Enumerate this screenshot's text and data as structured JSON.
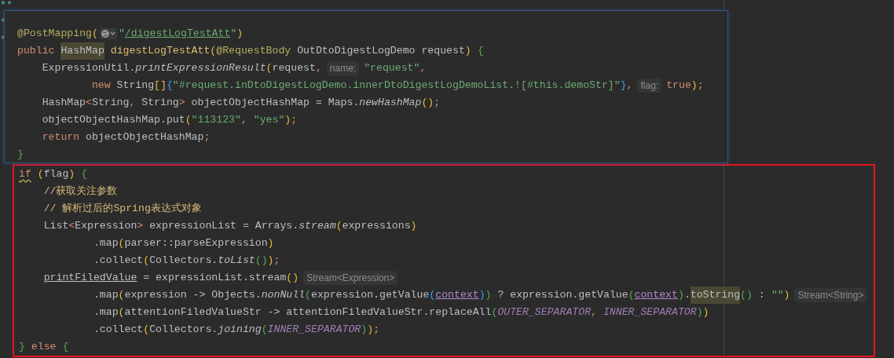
{
  "background_lines": [
    "**",
    "*",
    "*"
  ],
  "popup": {
    "lines": [
      {
        "kind": "top",
        "tokens": [
          {
            "kind": "ann",
            "text": "@PostMapping"
          },
          {
            "kind": "b1",
            "text": "("
          },
          {
            "kind": "url-icon"
          },
          {
            "kind": "str",
            "text": "\""
          },
          {
            "kind": "link",
            "text": "/digestLogTestAtt"
          },
          {
            "kind": "str",
            "text": "\""
          },
          {
            "kind": "b1",
            "text": ")"
          }
        ]
      },
      {
        "kind": "top",
        "tokens": [
          {
            "kind": "kw",
            "text": "public "
          },
          {
            "kind": "match",
            "text": "HashMap"
          },
          {
            "kind": "decl",
            "text": " digestLogTestAtt"
          },
          {
            "kind": "b1",
            "text": "("
          },
          {
            "kind": "ann",
            "text": "@RequestBody"
          },
          {
            "kind": "plain",
            "text": " OutDtoDigestLogDemo request"
          },
          {
            "kind": "b1",
            "text": ")"
          },
          {
            "kind": "b2",
            "text": " {"
          }
        ]
      },
      {
        "kind": "body",
        "tokens": [
          {
            "kind": "plain",
            "text": "ExpressionUtil."
          },
          {
            "kind": "static",
            "text": "printExpressionResult"
          },
          {
            "kind": "b1",
            "text": "("
          },
          {
            "kind": "plain",
            "text": "request"
          },
          {
            "kind": "kw",
            "text": ","
          },
          {
            "kind": "hint",
            "text": "name:"
          },
          {
            "kind": "str",
            "text": "\"request\""
          },
          {
            "kind": "kw",
            "text": ","
          }
        ]
      },
      {
        "kind": "cont",
        "tokens": [
          {
            "kind": "kw",
            "text": "new "
          },
          {
            "kind": "plain",
            "text": "String"
          },
          {
            "kind": "b1",
            "text": "[]"
          },
          {
            "kind": "b3",
            "text": "{"
          },
          {
            "kind": "str",
            "text": "\"#request.inDtoDigestLogDemo.innerDtoDigestLogDemoList.![#this.demoStr]\""
          },
          {
            "kind": "b3",
            "text": "}"
          },
          {
            "kind": "kw",
            "text": ","
          },
          {
            "kind": "hint",
            "text": "flag:"
          },
          {
            "kind": "kw",
            "text": "true"
          },
          {
            "kind": "b1",
            "text": ")"
          },
          {
            "kind": "kw",
            "text": ";"
          }
        ]
      },
      {
        "kind": "body",
        "tokens": [
          {
            "kind": "plain",
            "text": "HashMap"
          },
          {
            "kind": "kw",
            "text": "<"
          },
          {
            "kind": "plain",
            "text": "String"
          },
          {
            "kind": "kw",
            "text": ","
          },
          {
            "kind": "plain",
            "text": " String"
          },
          {
            "kind": "kw",
            "text": ">"
          },
          {
            "kind": "plain",
            "text": " objectObjectHashMap = Maps."
          },
          {
            "kind": "static",
            "text": "newHashMap"
          },
          {
            "kind": "b1",
            "text": "()"
          },
          {
            "kind": "kw",
            "text": ";"
          }
        ]
      },
      {
        "kind": "body",
        "tokens": [
          {
            "kind": "plain",
            "text": "objectObjectHashMap.put"
          },
          {
            "kind": "b1",
            "text": "("
          },
          {
            "kind": "str",
            "text": "\"113123\""
          },
          {
            "kind": "kw",
            "text": ","
          },
          {
            "kind": "str",
            "text": " \"yes\""
          },
          {
            "kind": "b1",
            "text": ")"
          },
          {
            "kind": "kw",
            "text": ";"
          }
        ]
      },
      {
        "kind": "body",
        "tokens": [
          {
            "kind": "kw",
            "text": "return "
          },
          {
            "kind": "plain",
            "text": "objectObjectHashMap"
          },
          {
            "kind": "kw",
            "text": ";"
          }
        ]
      },
      {
        "kind": "top",
        "tokens": [
          {
            "kind": "b2",
            "text": "}"
          }
        ]
      }
    ]
  },
  "highlighted_code": {
    "lines": [
      {
        "kind": "top",
        "tokens": [
          {
            "kind": "warn-kw",
            "text": "if"
          },
          {
            "kind": "b1",
            "text": " ("
          },
          {
            "kind": "plain",
            "text": "flag"
          },
          {
            "kind": "b1",
            "text": ")"
          },
          {
            "kind": "b2",
            "text": " {"
          }
        ]
      },
      {
        "kind": "body",
        "tokens": [
          {
            "kind": "comment",
            "text": "//获取关注参数"
          }
        ]
      },
      {
        "kind": "body",
        "tokens": [
          {
            "kind": "comment",
            "text": "// 解析过后的Spring表达式对象"
          }
        ]
      },
      {
        "kind": "body",
        "tokens": [
          {
            "kind": "plain",
            "text": "List"
          },
          {
            "kind": "kw",
            "text": "<"
          },
          {
            "kind": "plain",
            "text": "Expression"
          },
          {
            "kind": "kw",
            "text": ">"
          },
          {
            "kind": "plain",
            "text": " expressionList = Arrays."
          },
          {
            "kind": "static",
            "text": "stream"
          },
          {
            "kind": "b1",
            "text": "("
          },
          {
            "kind": "plain",
            "text": "expressions"
          },
          {
            "kind": "b1",
            "text": ")"
          }
        ]
      },
      {
        "kind": "cont",
        "tokens": [
          {
            "kind": "plain",
            "text": ".map"
          },
          {
            "kind": "b1",
            "text": "("
          },
          {
            "kind": "plain",
            "text": "parser::parseExpression"
          },
          {
            "kind": "b1",
            "text": ")"
          }
        ]
      },
      {
        "kind": "cont",
        "tokens": [
          {
            "kind": "plain",
            "text": ".collect"
          },
          {
            "kind": "b1",
            "text": "("
          },
          {
            "kind": "plain",
            "text": "Collectors."
          },
          {
            "kind": "static",
            "text": "toList"
          },
          {
            "kind": "b2",
            "text": "()"
          },
          {
            "kind": "b1",
            "text": ")"
          },
          {
            "kind": "kw",
            "text": ";"
          }
        ]
      },
      {
        "kind": "body",
        "tokens": [
          {
            "kind": "assigned",
            "text": "printFiledValue"
          },
          {
            "kind": "plain",
            "text": " = expressionList.stream"
          },
          {
            "kind": "b1",
            "text": "()"
          },
          {
            "kind": "hint",
            "text": "Stream<Expression>"
          }
        ]
      },
      {
        "kind": "cont",
        "tokens": [
          {
            "kind": "plain",
            "text": ".map"
          },
          {
            "kind": "b1",
            "text": "("
          },
          {
            "kind": "plain",
            "text": "expression -> Objects."
          },
          {
            "kind": "static",
            "text": "nonNull"
          },
          {
            "kind": "b2",
            "text": "("
          },
          {
            "kind": "plain",
            "text": "expression.getValue"
          },
          {
            "kind": "b3",
            "text": "("
          },
          {
            "kind": "field",
            "text": "context"
          },
          {
            "kind": "b3",
            "text": ")"
          },
          {
            "kind": "b2",
            "text": ")"
          },
          {
            "kind": "plain",
            "text": " ? expression.getValue"
          },
          {
            "kind": "b2",
            "text": "("
          },
          {
            "kind": "field",
            "text": "context"
          },
          {
            "kind": "b2",
            "text": ")"
          },
          {
            "kind": "plain",
            "text": "."
          },
          {
            "kind": "match",
            "text": "toString"
          },
          {
            "kind": "b2",
            "text": "()"
          },
          {
            "kind": "plain",
            "text": " :"
          },
          {
            "kind": "str",
            "text": " \"\""
          },
          {
            "kind": "b1",
            "text": ")"
          },
          {
            "kind": "hint",
            "text": "Stream<String>"
          }
        ]
      },
      {
        "kind": "cont",
        "tokens": [
          {
            "kind": "plain",
            "text": ".map"
          },
          {
            "kind": "b1",
            "text": "("
          },
          {
            "kind": "plain",
            "text": "attentionFiledValueStr -> attentionFiledValueStr.replaceAll"
          },
          {
            "kind": "b2",
            "text": "("
          },
          {
            "kind": "const",
            "text": "OUTER_SEPARATOR"
          },
          {
            "kind": "kw",
            "text": ","
          },
          {
            "kind": "const",
            "text": " INNER_SEPARATOR"
          },
          {
            "kind": "b2",
            "text": ")"
          },
          {
            "kind": "b1",
            "text": ")"
          }
        ]
      },
      {
        "kind": "cont",
        "tokens": [
          {
            "kind": "plain",
            "text": ".collect"
          },
          {
            "kind": "b1",
            "text": "("
          },
          {
            "kind": "plain",
            "text": "Collectors."
          },
          {
            "kind": "static",
            "text": "joining"
          },
          {
            "kind": "b2",
            "text": "("
          },
          {
            "kind": "const",
            "text": "INNER_SEPARATOR"
          },
          {
            "kind": "b2",
            "text": ")"
          },
          {
            "kind": "b1",
            "text": ")"
          },
          {
            "kind": "kw",
            "text": ";"
          }
        ]
      },
      {
        "kind": "top",
        "tokens": [
          {
            "kind": "b2",
            "text": "}"
          },
          {
            "kind": "kw",
            "text": " else"
          },
          {
            "kind": "b2",
            "text": " {"
          }
        ]
      }
    ]
  }
}
